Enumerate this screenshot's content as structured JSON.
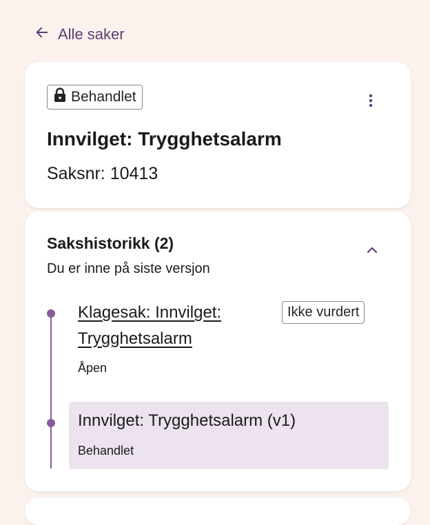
{
  "nav": {
    "back_label": "Alle saker"
  },
  "case": {
    "badge_label": "Behandlet",
    "title": "Innvilget: Trygghetsalarm",
    "case_number": "Saksnr: 10413"
  },
  "history": {
    "title": "Sakshistorikk (2)",
    "subtitle": "Du er inne på siste versjon",
    "items": [
      {
        "title": "Klagesak: Innvilget: Trygghetsalarm",
        "status_chip": "Ikke vurdert",
        "sub": "Åpen"
      },
      {
        "title": "Innvilget: Trygghetsalarm (v1)",
        "sub": "Behandlet"
      }
    ]
  },
  "colors": {
    "accent": "#8a5a9e",
    "background": "#fbf2ee",
    "selected": "#ece3ee",
    "link": "#5e3d73"
  },
  "icons": {
    "back": "arrow-left-icon",
    "badge": "lock-icon",
    "menu": "kebab-menu-icon",
    "collapse": "chevron-up-icon"
  }
}
